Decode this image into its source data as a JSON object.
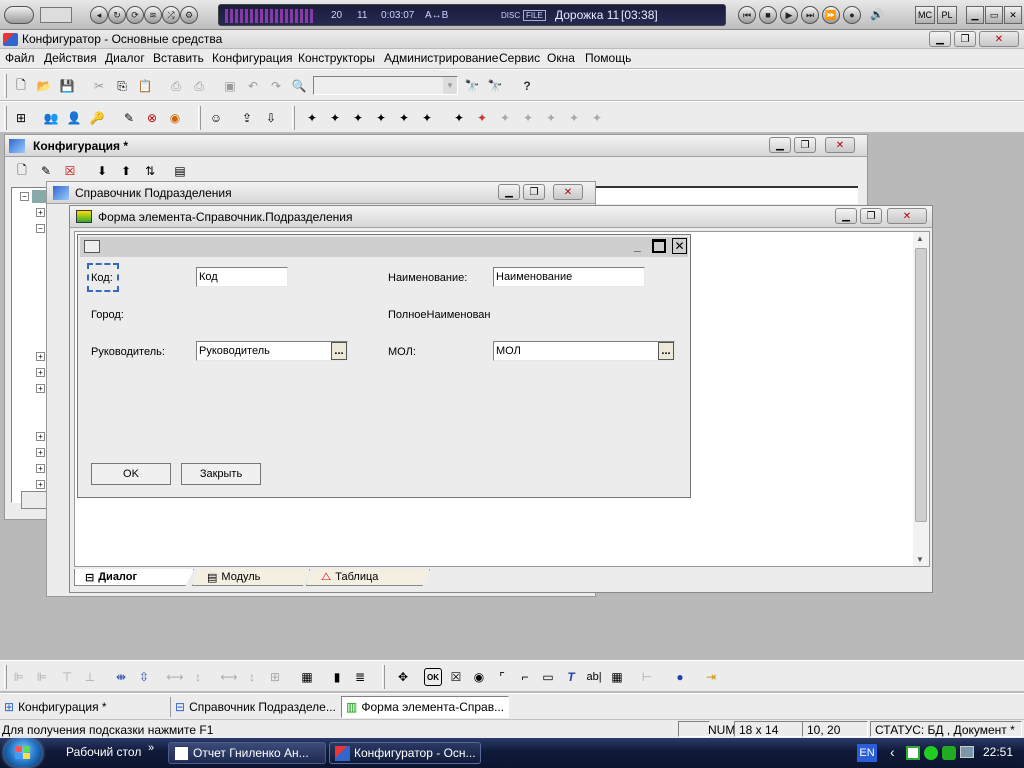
{
  "player": {
    "track_num": "20",
    "track_sub": "11",
    "time": "0:03:07",
    "ab": "A↔B",
    "disc": "DISC",
    "file": "FILE",
    "track_title": "Дорожка 11",
    "track_len": "[03:38]",
    "mc": "MC",
    "pl": "PL"
  },
  "app": {
    "title": "Конфигуратор - Основные средства"
  },
  "menu": [
    "Файл",
    "Действия",
    "Диалог",
    "Вставить",
    "Конфигурация",
    "Конструкторы",
    "Администрирование",
    "Сервис",
    "Окна",
    "Помощь"
  ],
  "config_window": {
    "title": "Конфигурация *"
  },
  "directory_window": {
    "title": "Справочник Подразделения"
  },
  "form_window": {
    "title": "Форма элемента-Справочник.Подразделения"
  },
  "dialog": {
    "code_label": "Код:",
    "code_value": "Код",
    "name_label": "Наименование:",
    "name_value": "Наименование",
    "city_label": "Город:",
    "fullname_label": "ПолноеНаименован",
    "head_label": "Руководитель:",
    "head_value": "Руководитель",
    "mol_label": "МОЛ:",
    "mol_value": "МОЛ",
    "dots": "...",
    "ok": "OK",
    "close": "Закрыть"
  },
  "form_tabs": [
    "Диалог",
    "Модуль",
    "Таблица"
  ],
  "window_tabs": [
    "Конфигурация *",
    "Справочник Подразделе...",
    "Форма элемента-Справ..."
  ],
  "status": {
    "hint": "Для получения подсказки нажмите F1",
    "num": "NUM",
    "size": "18 x 14",
    "pos": "10, 20",
    "state": "СТАТУС: БД , Документ *"
  },
  "taskbar": {
    "desktop": "Рабочий стол",
    "chevron": "»",
    "items": [
      "Отчет Гниленко Ан...",
      "Конфигуратор - Осн..."
    ],
    "lang": "EN",
    "clock": "22:51"
  },
  "colors": {
    "accent": "#316ac5",
    "taskbar": "#0c1530",
    "close_red": "#b00000"
  }
}
